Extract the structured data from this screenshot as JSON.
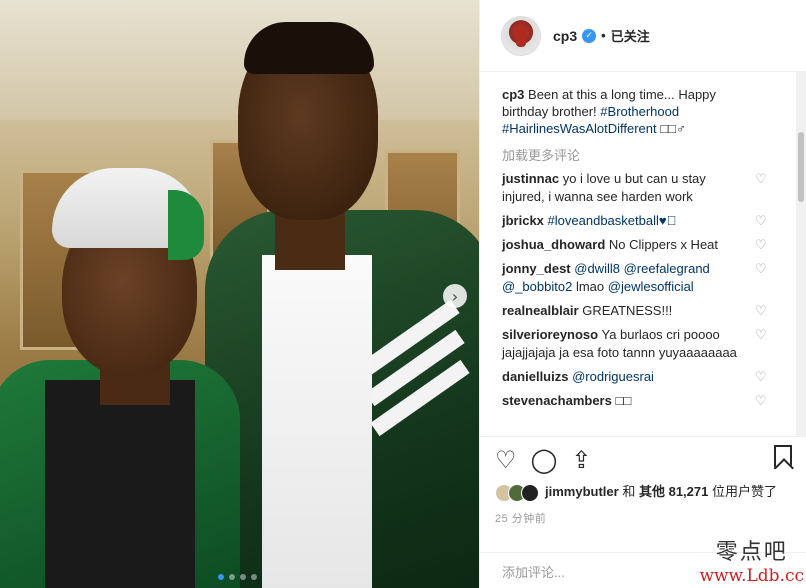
{
  "header": {
    "username": "cp3",
    "separator": "•",
    "follow_label": "已关注"
  },
  "caption": {
    "username": "cp3",
    "text": "Been at this a long time... Happy birthday brother!",
    "hashtag1": "#Brotherhood",
    "hashtag2": "#HairlinesWasAlotDifferent",
    "emoji": "□□♂"
  },
  "load_more": "加载更多评论",
  "comments": [
    {
      "user": "justinnac",
      "text": "yo i love u but can u stay injured, i wanna see harden work"
    },
    {
      "user": "jbrickx",
      "text": "#loveandbasketball♥",
      "suffix": "🏽"
    },
    {
      "user": "joshua_dhoward",
      "text": "No Clippers x Heat"
    },
    {
      "user": "jonny_dest",
      "m1": "@dwill8",
      "m2": "@reefalegrand",
      "m3": "@_bobbito2",
      "mid": "lmao",
      "m4": "@jewlesofficial"
    },
    {
      "user": "realnealblair",
      "text": "GREATNESS!!!"
    },
    {
      "user": "silverioreynoso",
      "text": "Ya burlaos cri poooo jajajjajaja ja esa foto tannn yuyaaaaaaaa"
    },
    {
      "user": "danielluizs",
      "m1": "@rodriguesrai"
    },
    {
      "user": "stevenachambers",
      "text": "□□"
    }
  ],
  "likes": {
    "lead_user": "jimmybutler",
    "and": "和",
    "others_prefix": "其他",
    "count": "81,271",
    "suffix": "位用户赞了"
  },
  "time": "25 分钟前",
  "add_comment_placeholder": "添加评论...",
  "watermark": {
    "line1": "零点吧",
    "line2": "www.Ldb.cc"
  },
  "icons": {
    "like": "heart-icon",
    "comment": "comment-bubble-icon",
    "share": "share-icon",
    "save": "bookmark-icon",
    "verified": "verified-badge-icon",
    "next": "chevron-right-icon"
  },
  "colors": {
    "accent": "#3897f0",
    "link": "#003569",
    "muted": "#999999"
  }
}
